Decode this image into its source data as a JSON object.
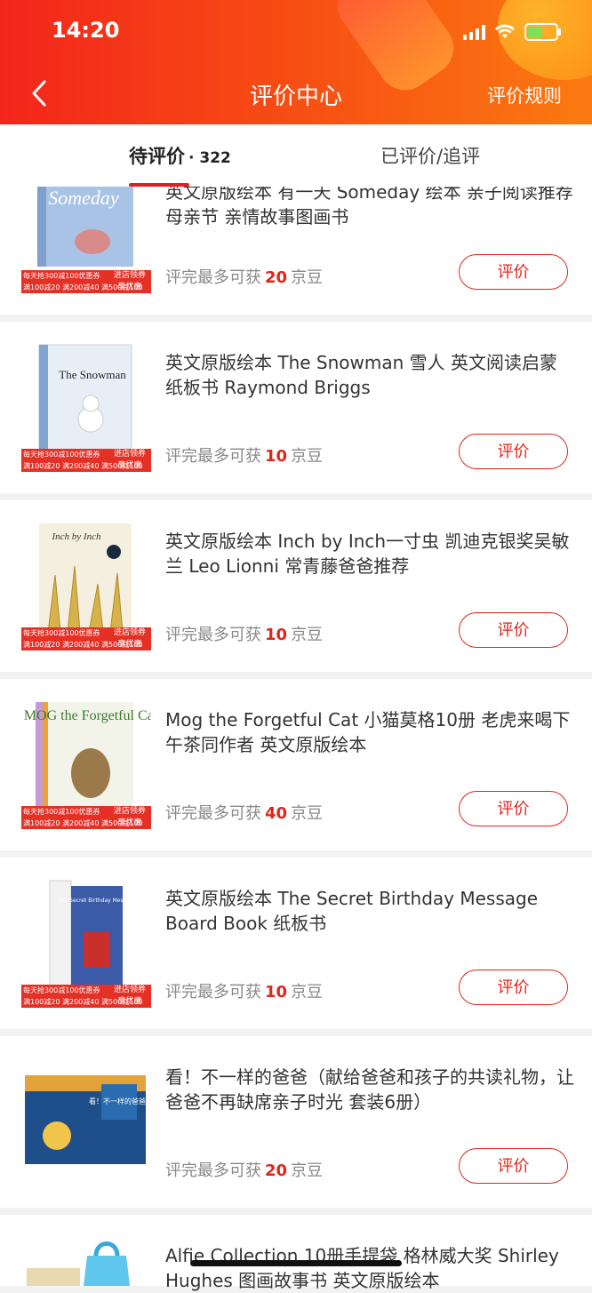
{
  "status": {
    "time": "14:20"
  },
  "header": {
    "title": "评价中心",
    "rules": "评价规则"
  },
  "tabs": [
    {
      "label": "待评价",
      "count": "· 322"
    },
    {
      "label": "已评价/追评"
    }
  ],
  "promo": {
    "left_line1": "每天抢300减100优惠券",
    "left_line2": "满100减20 满200减40 满500减100",
    "right_line1": "进店领券",
    "right_line2": "享优惠"
  },
  "products": [
    {
      "name": "英文原版绘本 有一天 Someday 绘本 亲子阅读推荐 母亲节 亲情故事图画书",
      "reward_prefix": "评完最多可获",
      "reward_num": "20",
      "reward_unit": "京豆",
      "button": "评价",
      "cover_text": "Someday"
    },
    {
      "name": "英文原版绘本 The Snowman 雪人 英文阅读启蒙纸板书 Raymond Briggs",
      "reward_prefix": "评完最多可获",
      "reward_num": "10",
      "reward_unit": "京豆",
      "button": "评价",
      "cover_text": "The Snowman"
    },
    {
      "name": "英文原版绘本 Inch by Inch一寸虫 凯迪克银奖吴敏兰 Leo Lionni 常青藤爸爸推荐",
      "reward_prefix": "评完最多可获",
      "reward_num": "10",
      "reward_unit": "京豆",
      "button": "评价",
      "cover_text": "Inch by Inch"
    },
    {
      "name": "Mog the Forgetful Cat 小猫莫格10册 老虎来喝下午茶同作者 英文原版绘本",
      "reward_prefix": "评完最多可获",
      "reward_num": "40",
      "reward_unit": "京豆",
      "button": "评价",
      "cover_text": "MOG the Forgetful Cat"
    },
    {
      "name": "英文原版绘本 The Secret Birthday Message Board Book 纸板书",
      "reward_prefix": "评完最多可获",
      "reward_num": "10",
      "reward_unit": "京豆",
      "button": "评价",
      "cover_text": "The Secret Birthday Message"
    },
    {
      "name": "看！不一样的爸爸（献给爸爸和孩子的共读礼物，让爸爸不再缺席亲子时光 套装6册）",
      "reward_prefix": "评完最多可获",
      "reward_num": "20",
      "reward_unit": "京豆",
      "button": "评价",
      "cover_text": "看！不一样的爸爸"
    },
    {
      "name": "Alfie Collection 10册手提袋 格林威大奖 Shirley Hughes 图画故事书 英文原版绘本"
    }
  ]
}
